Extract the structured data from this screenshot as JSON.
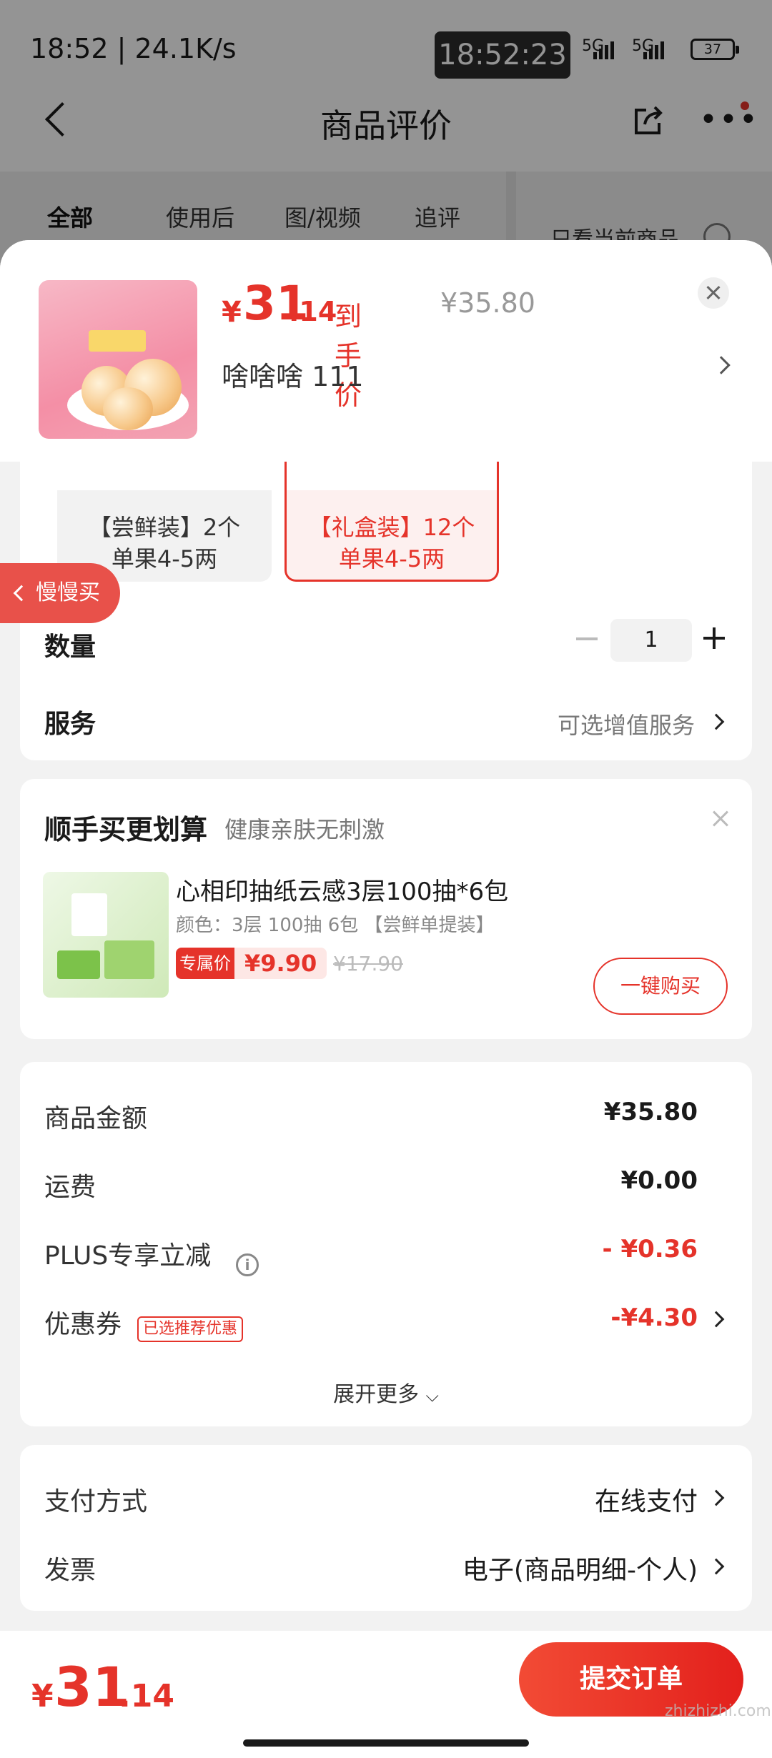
{
  "status_bar": {
    "time_speed": "18:52 | 24.1K/s",
    "clock": "18:52:23",
    "net1": "5G",
    "net2": "5G",
    "battery": "37"
  },
  "nav": {
    "title": "商品评价"
  },
  "filter_tabs": [
    {
      "label": "全部"
    },
    {
      "label": "使用后"
    },
    {
      "label": "图/视频"
    },
    {
      "label": "追评"
    }
  ],
  "only_current_label": "只看当前商品",
  "sheet": {
    "price": {
      "yen": "¥",
      "int": "31",
      "dec": ".14",
      "label": "到手价",
      "original": "¥35.80"
    },
    "selected_spec": "啥啥啥  111",
    "options": [
      {
        "line1": "【尝鲜装】2个",
        "line2": "单果4-5两"
      },
      {
        "line1": "【礼盒装】12个",
        "line2": "单果4-5两"
      }
    ],
    "quantity_label": "数量",
    "quantity_value": "1",
    "service_label": "服务",
    "service_value": "可选增值服务"
  },
  "slow_buy": "慢慢买",
  "bundle": {
    "title": "顺手买更划算",
    "subtitle": "健康亲肤无刺激",
    "product_name": "心相印抽纸云感3层100抽*6包",
    "attr": "颜色：3层 100抽 6包 【尝鲜单提装】",
    "price_tag": "专属价",
    "price": "¥9.90",
    "original": "¥17.90",
    "button": "一键购买"
  },
  "breakdown": {
    "rows": [
      {
        "label": "商品金额",
        "value": "¥35.80"
      },
      {
        "label": "运费",
        "value": "¥0.00"
      },
      {
        "label": "PLUS专享立减",
        "value": "- ¥0.36"
      },
      {
        "label": "优惠券",
        "value": "-¥4.30"
      }
    ],
    "coupon_tag": "已选推荐优惠",
    "expand": "展开更多"
  },
  "payment": {
    "rows": [
      {
        "label": "支付方式",
        "value": "在线支付"
      },
      {
        "label": "发票",
        "value": "电子(商品明细-个人)"
      }
    ]
  },
  "bottom": {
    "yen": "¥",
    "int": "31",
    "dec": ".14",
    "submit": "提交订单"
  },
  "watermark": "zhizhizhi.com",
  "colors": {
    "accent": "#e5332a",
    "background": "#f2f2f2"
  }
}
